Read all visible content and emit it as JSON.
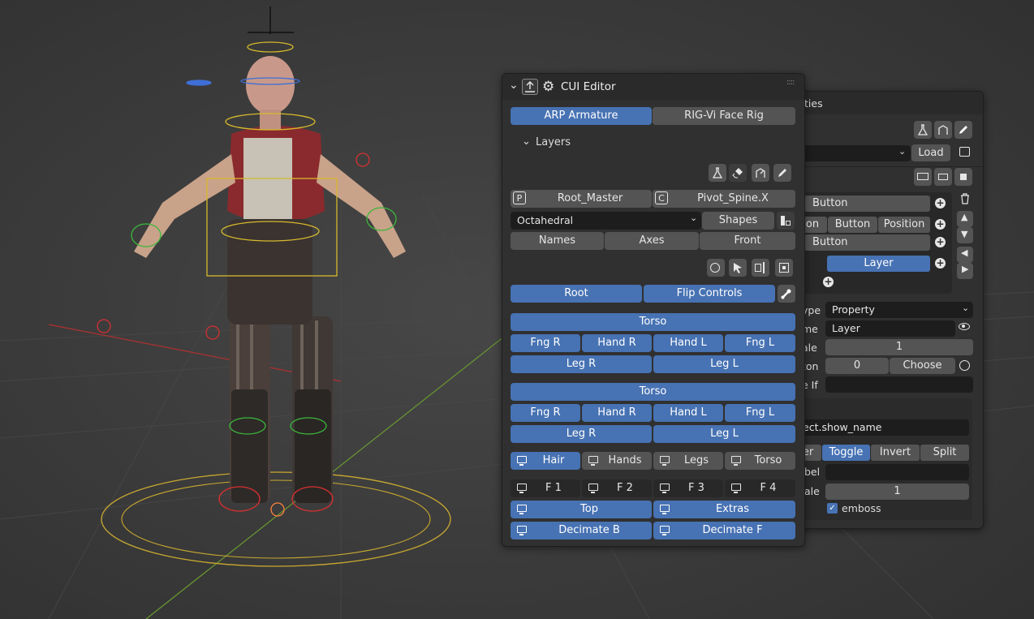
{
  "cui_panel": {
    "title": "CUI Editor",
    "tabs": [
      "ARP Armature",
      "RIG-Vi Face Rig"
    ],
    "layers_heading": "Layers",
    "rows": {
      "bones": [
        {
          "badge": "P",
          "label": "Root_Master"
        },
        {
          "badge": "C",
          "label": "Pivot_Spine.X"
        }
      ],
      "shape_select": "Octahedral",
      "shapes_label": "Shapes",
      "display_modes": [
        "Names",
        "Axes",
        "Front"
      ],
      "root_label": "Root",
      "flip_label": "Flip Controls",
      "group1": {
        "header": "Torso",
        "limbs": [
          "Fng R",
          "Hand R",
          "Hand L",
          "Fng L"
        ],
        "legs": [
          "Leg R",
          "Leg L"
        ]
      },
      "group2": {
        "header": "Torso",
        "limbs": [
          "Fng R",
          "Hand R",
          "Hand L",
          "Fng L"
        ],
        "legs": [
          "Leg R",
          "Leg L"
        ]
      },
      "visibility": [
        "Hair",
        "Hands",
        "Legs",
        "Torso"
      ],
      "function_keys": [
        "F 1",
        "F 2",
        "F 3",
        "F 4"
      ],
      "view_top": "Top",
      "view_extras": "Extras",
      "decimate_b": "Decimate B",
      "decimate_f": "Decimate F"
    }
  },
  "properties_panel": {
    "title_fragment": "ties",
    "load_label": "Load",
    "list_rows": {
      "row1": "Button",
      "row2": [
        "on",
        "Button",
        "Position"
      ],
      "row3": "Button",
      "row4": "Layer"
    },
    "props": [
      {
        "label": "ype",
        "value": "Property"
      },
      {
        "label": "me",
        "value": "Layer"
      },
      {
        "label": "ale",
        "value": "1"
      },
      {
        "label": "ton",
        "value": "0",
        "extra": "Choose"
      },
      {
        "label": "e If",
        "value": ""
      }
    ],
    "sub": {
      "path": "ect.show_name",
      "modes": [
        "er",
        "Toggle",
        "Invert",
        "Split"
      ],
      "label_label": "bel",
      "label_value": "",
      "scale_label": "ale",
      "scale_value": "1",
      "emboss_label": "emboss"
    }
  },
  "colors": {
    "accent": "#4772b3",
    "panel_bg": "#303030",
    "button": "#545454",
    "field": "#1d1d1d",
    "viewport": "#3a3a3a"
  }
}
